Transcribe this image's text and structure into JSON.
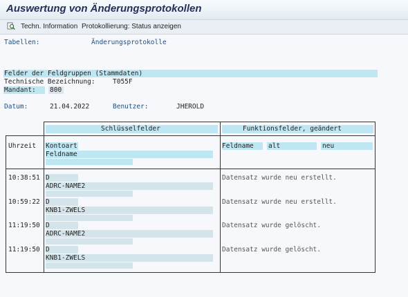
{
  "window": {
    "title": "Auswertung von Änderungsprotokollen"
  },
  "toolbar": {
    "icon": "magnifier-document-icon",
    "btn1": "Techn. Information",
    "btn2": "Protokollierung: Status anzeigen"
  },
  "report": {
    "tables_label": "Tabellen:",
    "tables_value": "Änderungsprotokolle",
    "group_title": "Felder der Feldgruppen (Stammdaten)",
    "techname_label": "Technische Bezeichnung:",
    "techname_value": "T055F",
    "client_label": "Mandant:",
    "client_value": "800",
    "date_label": "Datum:",
    "date_value": "21.04.2022",
    "user_label": "Benutzer:",
    "user_value": "JHEROLD"
  },
  "table": {
    "key_header": "Schlüsselfelder",
    "func_header": "Funktionsfelder, geändert",
    "col_time": "Uhrzeit",
    "key_field1": "Kontoart",
    "key_field2": "Feldname",
    "func_field": "Feldname",
    "func_old": "alt",
    "func_new": "neu",
    "rows": [
      {
        "time": "10:38:51",
        "kontoart": "D",
        "feldname": "ADRC-NAME2",
        "text": "Datensatz wurde neu erstellt."
      },
      {
        "time": "10:59:22",
        "kontoart": "D",
        "feldname": "KNB1-ZWELS",
        "text": "Datensatz wurde neu erstellt."
      },
      {
        "time": "11:19:50",
        "kontoart": "D",
        "feldname": "ADRC-NAME2",
        "text": "Datensatz wurde gelöscht."
      },
      {
        "time": "11:19:50",
        "kontoart": "D",
        "feldname": "KNB1-ZWELS",
        "text": "Datensatz wurde gelöscht."
      }
    ]
  }
}
